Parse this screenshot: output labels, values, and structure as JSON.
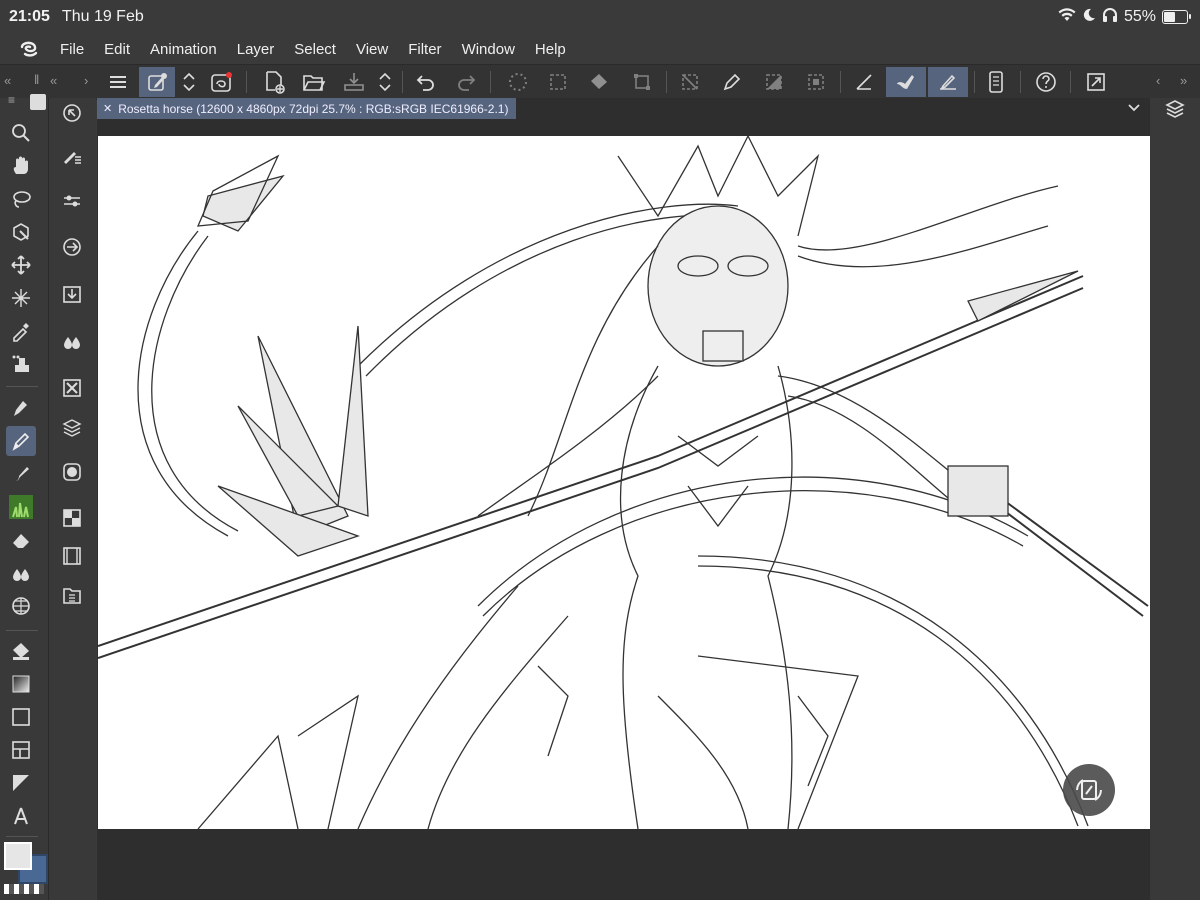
{
  "status": {
    "time": "21:05",
    "date": "Thu 19 Feb",
    "battery": "55%",
    "battery_level": 0.55,
    "icons": [
      "wifi-icon",
      "moon-icon",
      "headphones-icon",
      "battery-icon"
    ]
  },
  "menubar": {
    "logo": "clip-studio-logo",
    "items": [
      "File",
      "Edit",
      "Animation",
      "Layer",
      "Select",
      "View",
      "Filter",
      "Window",
      "Help"
    ]
  },
  "toolbar": {
    "buttons": [
      "hamburger-menu-icon",
      "edit-icon",
      "chevron-updown-icon",
      "companion-icon",
      "new-file-icon",
      "open-folder-icon",
      "save-icon",
      "chevron-updown-icon",
      "undo-icon",
      "redo-icon",
      "loading-icon",
      "select-all-icon",
      "fill-icon",
      "transform-icon",
      "deselect-icon",
      "pen-icon",
      "invert-selection-icon",
      "selection-icon",
      "ruler-icon",
      "brush-icon",
      "ruler-pen-icon",
      "phone-icon",
      "help-icon",
      "fullscreen-icon"
    ]
  },
  "canvas": {
    "tab_title": "Rosetta horse (12600 x 4860px 72dpi 25.7% : RGB:sRGB IEC61966-2.1)"
  },
  "tools": {
    "main": [
      "zoom-icon",
      "hand-icon",
      "lasso-icon",
      "object-icon",
      "move-icon",
      "auto-select-icon",
      "eyedropper-icon",
      "stamp-icon",
      "pen-tool-icon",
      "pencil-tool-icon",
      "marker-icon",
      "grass-brush-icon",
      "eraser-icon",
      "blend-icon",
      "perspective-icon",
      "fill-bucket-icon",
      "gradient-icon",
      "rectangle-icon",
      "frame-icon",
      "ruler-tool-icon",
      "text-icon"
    ],
    "active": "pencil-tool-icon",
    "sub": [
      "cursor-icon",
      "brush-settings-icon",
      "slider-icon",
      "transfer-icon",
      "import-icon",
      "drops-icon",
      "cross-icon",
      "layers-plus-icon",
      "circle-icon",
      "grid-icon",
      "film-icon",
      "folder-grid-icon"
    ]
  },
  "colors": {
    "foreground": "#e6e6e6",
    "background": "#4a6894",
    "accent": "#56647e"
  }
}
